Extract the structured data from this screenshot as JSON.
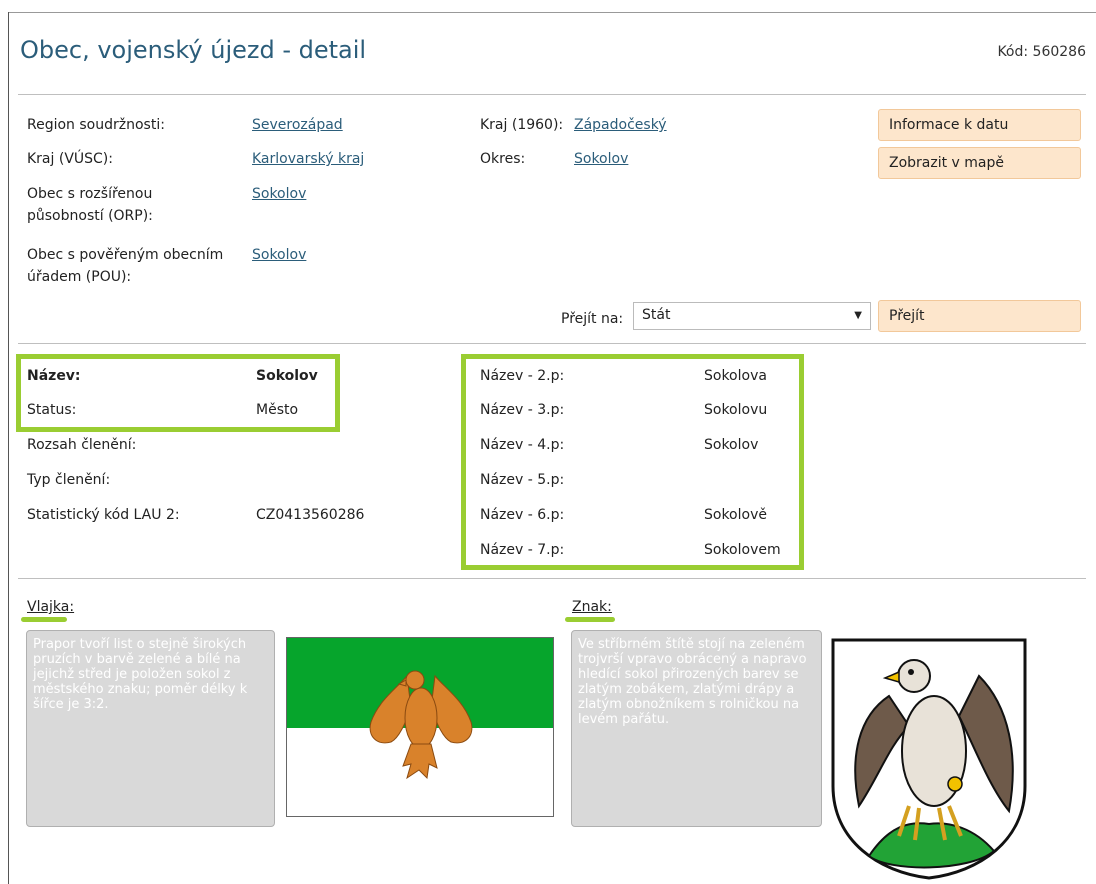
{
  "header": {
    "title": "Obec, vojenský újezd - detail",
    "code": "Kód: 560286"
  },
  "info": {
    "region_label": "Region soudržnosti:",
    "region_value": "Severozápad",
    "kraj1960_label": "Kraj (1960):",
    "kraj1960_value": "Západočeský",
    "vusc_label": "Kraj (VÚSC):",
    "vusc_value": "Karlovarský kraj",
    "okres_label": "Okres:",
    "okres_value": "Sokolov",
    "orp_label_1": "Obec s rozšířenou",
    "orp_label_2": "působností (ORP):",
    "orp_value": "Sokolov",
    "pou_label_1": "Obec s pověřeným obecním",
    "pou_label_2": "úřadem (POU):",
    "pou_value": "Sokolov"
  },
  "buttons": {
    "info_date": "Informace k datu",
    "show_map": "Zobrazit v mapě",
    "go": "Přejít"
  },
  "goto": {
    "label": "Přejít na:",
    "selected": "Stát"
  },
  "details": {
    "nazev_label": "Název:",
    "nazev_value": "Sokolov",
    "status_label": "Status:",
    "status_value": "Město",
    "rozsah_label": "Rozsah členění:",
    "typ_label": "Typ členění:",
    "lau_label": "Statistický kód LAU 2:",
    "lau_value": "CZ0413560286"
  },
  "declension": [
    {
      "label": "Název - 2.p:",
      "value": "Sokolova"
    },
    {
      "label": "Název - 3.p:",
      "value": "Sokolovu"
    },
    {
      "label": "Název - 4.p:",
      "value": "Sokolov"
    },
    {
      "label": "Název - 5.p:",
      "value": ""
    },
    {
      "label": "Název - 6.p:",
      "value": "Sokolově"
    },
    {
      "label": "Název - 7.p:",
      "value": "Sokolovem"
    }
  ],
  "flag": {
    "heading": "Vlajka:",
    "description": "Prapor tvoří list o stejně širokých pruzích v barvě zelené a bílé na jejichž střed je položen sokol z městského znaku; poměr délky k šířce je 3:2.",
    "green": "#06a52c",
    "white": "#ffffff",
    "falcon_color": "#d9822b"
  },
  "coat_of_arms": {
    "heading": "Znak:",
    "description": "Ve stříbrném štítě stojí na zeleném trojvrší vpravo obrácený a napravo hledící sokol přirozených barev se zlatým zobákem, zlatými drápy a zlatým obnožníkem s rolničkou na levém pařátu."
  },
  "colors": {
    "title": "#2b5d7a",
    "link": "#2b5d7a",
    "button_bg": "#fde6cc",
    "highlight": "#9acd32",
    "desc_bg": "#d9d9d9"
  }
}
